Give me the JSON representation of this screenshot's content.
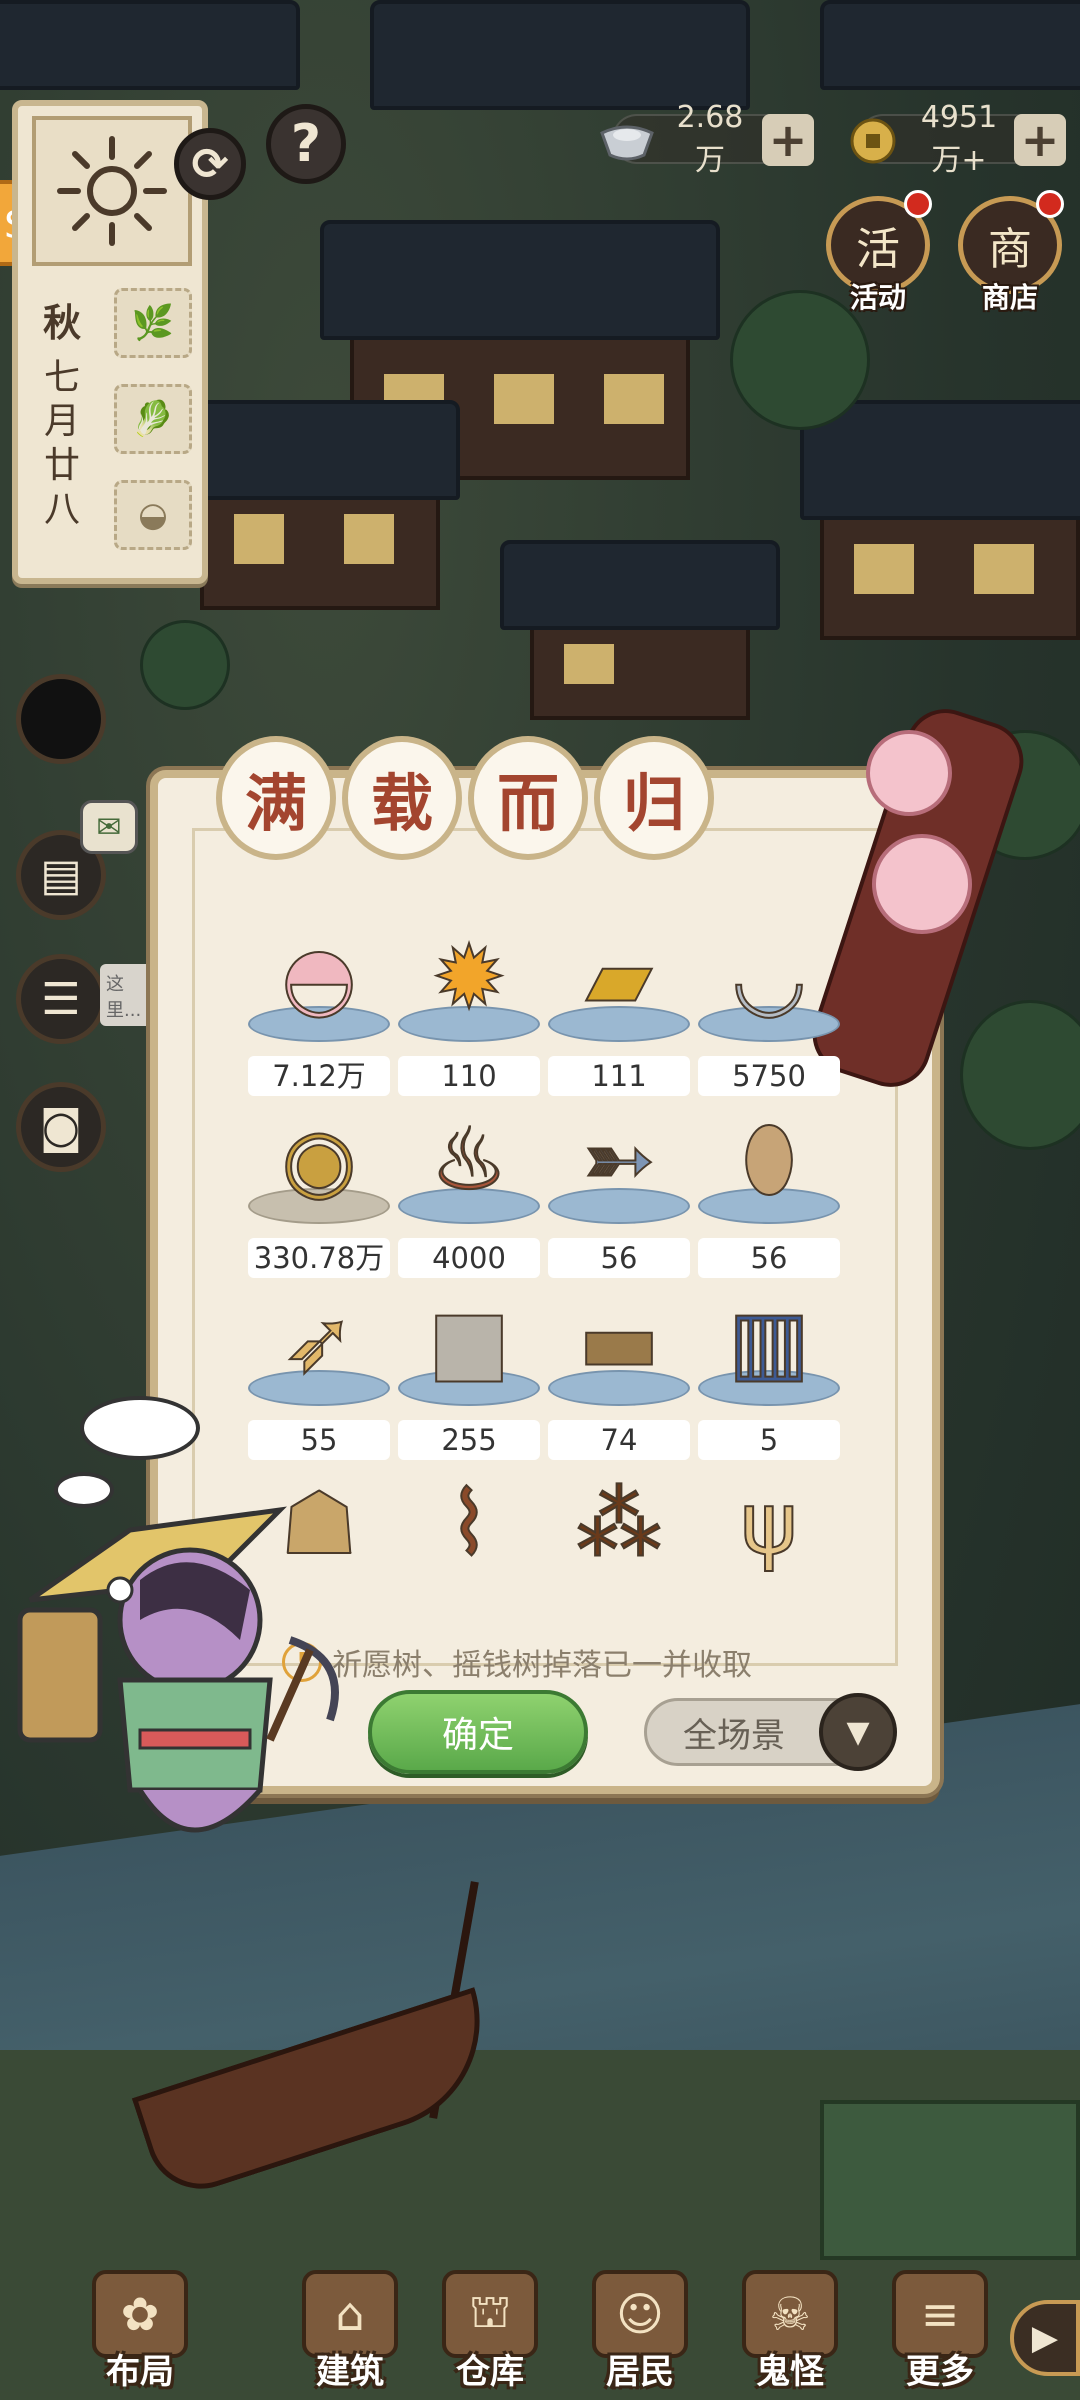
{
  "calendar": {
    "season": "秋",
    "date": "七月廿八",
    "slots": [
      "scallion-icon",
      "leek-icon",
      "bread-icon"
    ]
  },
  "currency": [
    {
      "icon": "silver-ingot-icon",
      "value": "2.68万"
    },
    {
      "icon": "copper-coin-icon",
      "value": "4951万+"
    }
  ],
  "corner_buttons": {
    "event": "活动",
    "event_glyph": "活",
    "shop": "商店",
    "shop_glyph": "商"
  },
  "side_tools": {
    "chat_hint": "这里..."
  },
  "modal": {
    "title": [
      "满",
      "载",
      "而",
      "归"
    ],
    "items": [
      {
        "name": "shell-icon",
        "count": "7.12万",
        "platform": "blue"
      },
      {
        "name": "fire-essence-icon",
        "count": "110",
        "platform": "blue"
      },
      {
        "name": "gold-paper-icon",
        "count": "111",
        "platform": "blue"
      },
      {
        "name": "silver-ingot-icon",
        "count": "5750",
        "platform": "blue"
      },
      {
        "name": "copper-coin-icon",
        "count": "330.78万",
        "platform": "gray"
      },
      {
        "name": "meat-leg-icon",
        "count": "4000",
        "platform": "blue"
      },
      {
        "name": "fish-icon",
        "count": "56",
        "platform": "blue"
      },
      {
        "name": "taro-icon",
        "count": "56",
        "platform": "blue"
      },
      {
        "name": "carp-icon",
        "count": "55",
        "platform": "blue"
      },
      {
        "name": "stone-block-icon",
        "count": "255",
        "platform": "blue"
      },
      {
        "name": "wood-log-icon",
        "count": "74",
        "platform": "blue"
      },
      {
        "name": "book-icon",
        "count": "5",
        "platform": "blue"
      },
      {
        "name": "rice-sack-icon",
        "count": "",
        "platform": "none"
      },
      {
        "name": "ginseng-root-icon",
        "count": "",
        "platform": "none"
      },
      {
        "name": "tea-leaves-icon",
        "count": "",
        "platform": "none"
      },
      {
        "name": "antler-icon",
        "count": "",
        "platform": "none"
      }
    ],
    "tip": "祈愿树、摇钱树掉落已一并收取",
    "confirm": "确定",
    "scope": "全场景"
  },
  "nav": [
    {
      "label": "布局",
      "icon": "layout-icon"
    },
    {
      "label": "建筑",
      "icon": "building-icon"
    },
    {
      "label": "仓库",
      "icon": "warehouse-icon"
    },
    {
      "label": "居民",
      "icon": "resident-icon"
    },
    {
      "label": "鬼怪",
      "icon": "ghost-icon"
    },
    {
      "label": "更多",
      "icon": "more-icon"
    }
  ],
  "colors": {
    "modal_bg": "#f4eddf",
    "modal_border": "#c9b489",
    "title_text": "#a3452f",
    "confirm_green": "#5aa94a",
    "platform_blue": "#9bb8d1"
  }
}
